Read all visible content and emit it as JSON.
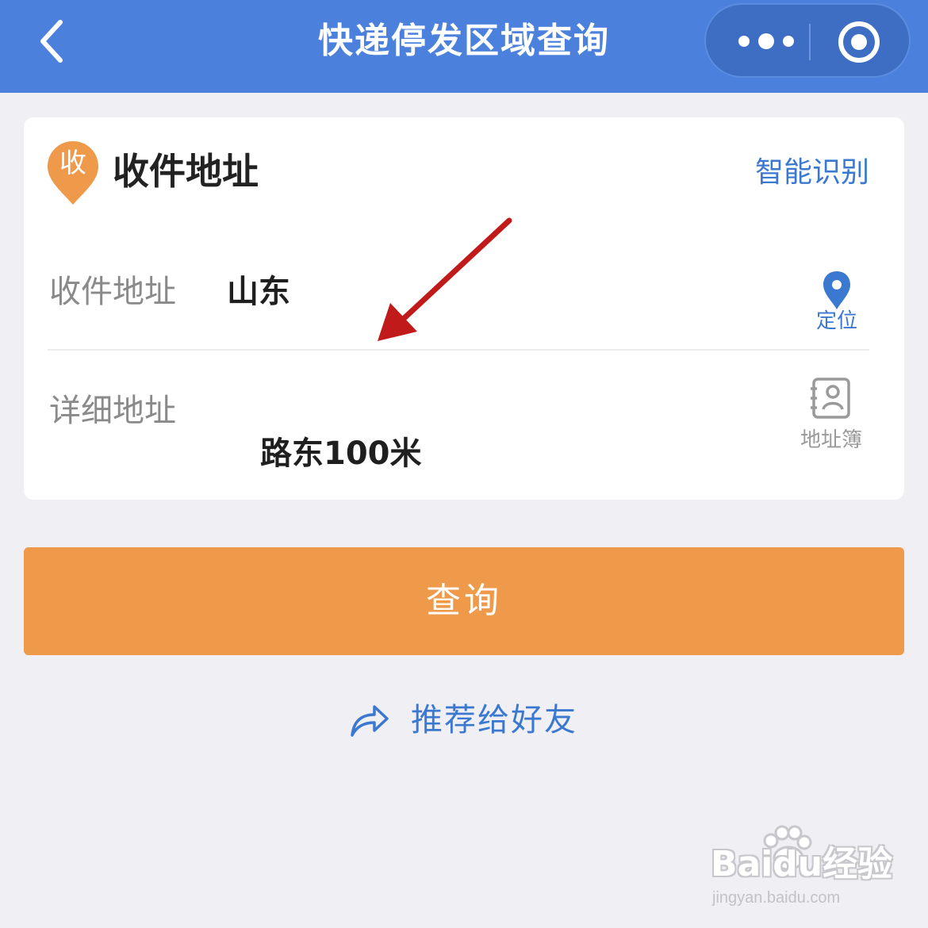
{
  "header": {
    "title": "快递停发区域查询",
    "back_icon": "chevron-left-icon",
    "more_icon": "more-dots-icon",
    "close_icon": "target-close-icon",
    "background": "#4b80dc"
  },
  "card": {
    "badge_letter": "收",
    "badge_color": "#ef9a4a",
    "title": "收件地址",
    "smart_recognize": "智能识别",
    "address_label": "收件地址",
    "address_value": "山东",
    "locate_label": "定位",
    "detail_label": "详细地址",
    "detail_value": "路东100米",
    "address_book_label": "地址簿"
  },
  "query_button": {
    "label": "查询",
    "color": "#ef9a4a"
  },
  "share": {
    "label": "推荐给好友",
    "icon": "share-arrow-icon"
  },
  "watermark": {
    "brand": "Baidu经验",
    "url": "jingyan.baidu.com"
  },
  "accent_color": "#3b78d0",
  "annotation_color": "#c01a1a"
}
